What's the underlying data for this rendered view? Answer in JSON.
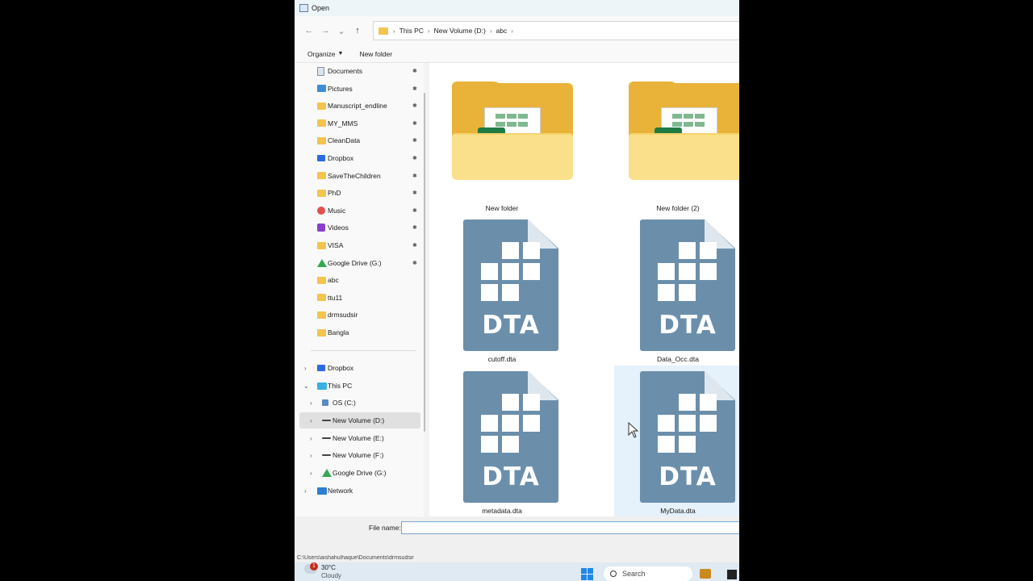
{
  "window": {
    "title": "Open"
  },
  "address": {
    "crumbs": [
      "This PC",
      "New Volume (D:)",
      "abc"
    ]
  },
  "commands": {
    "organize": "Organize",
    "new_folder": "New folder"
  },
  "quick_access": [
    {
      "label": "Documents",
      "icon": "document-icon"
    },
    {
      "label": "Pictures",
      "icon": "pictures-icon"
    },
    {
      "label": "Manuscript_endline",
      "icon": "folder-icon"
    },
    {
      "label": "MY_MMS",
      "icon": "folder-icon"
    },
    {
      "label": "CleanData",
      "icon": "folder-icon"
    },
    {
      "label": "Dropbox",
      "icon": "dropbox-icon"
    },
    {
      "label": "SaveTheChildren",
      "icon": "folder-icon"
    },
    {
      "label": "PhD",
      "icon": "folder-icon"
    },
    {
      "label": "Music",
      "icon": "music-icon"
    },
    {
      "label": "Videos",
      "icon": "videos-icon"
    },
    {
      "label": "VISA",
      "icon": "folder-icon"
    },
    {
      "label": "Google Drive (G:)",
      "icon": "google-drive-icon"
    },
    {
      "label": "abc",
      "icon": "folder-icon"
    },
    {
      "label": "ttu11",
      "icon": "folder-icon"
    },
    {
      "label": "drmsudsir",
      "icon": "folder-icon"
    },
    {
      "label": "Bangla",
      "icon": "folder-icon"
    }
  ],
  "tree": {
    "dropbox": "Dropbox",
    "this_pc": "This PC",
    "os_c": "OS (C:)",
    "vol_d": "New Volume (D:)",
    "vol_e": "New Volume (E:)",
    "vol_f": "New Volume (F:)",
    "gdrive": "Google Drive (G:)",
    "network": "Network"
  },
  "files": [
    {
      "name": "New folder",
      "type": "folder"
    },
    {
      "name": "New folder (2)",
      "type": "folder"
    },
    {
      "name": "cutoff.dta",
      "type": "dta",
      "badge": "DTA"
    },
    {
      "name": "Data_Occ.dta",
      "type": "dta",
      "badge": "DTA"
    },
    {
      "name": "metadata.dta",
      "type": "dta",
      "badge": "DTA"
    },
    {
      "name": "MyData.dta",
      "type": "dta",
      "badge": "DTA"
    }
  ],
  "filename": {
    "label": "File name:",
    "value": ""
  },
  "status_path": "C:\\Users\\aishahulhaque\\Documents\\drmsudsir",
  "taskbar": {
    "weather_temp": "30°C",
    "weather_desc": "Cloudy",
    "weather_badge": "1",
    "search_placeholder": "Search"
  }
}
